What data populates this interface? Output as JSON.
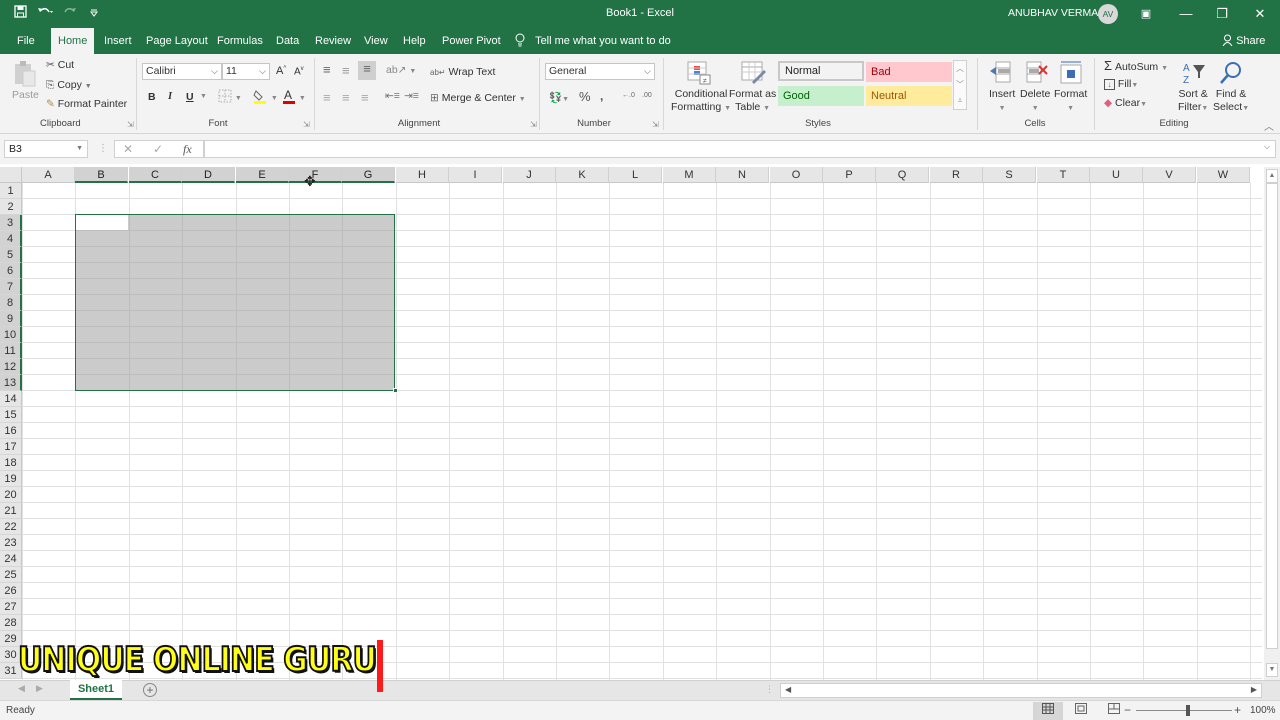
{
  "titlebar": {
    "doc_title": "Book1",
    "app_name": "Excel",
    "title_sep": "-",
    "user_name": "ANUBHAV VERMA",
    "user_initials": "AV",
    "qat": {
      "save": "save-icon",
      "undo": "undo-icon",
      "redo": "redo-icon",
      "customize": "customize-icon"
    },
    "window_controls": {
      "ribbon_display": "▣",
      "minimize": "—",
      "restore": "❐",
      "close": "✕"
    }
  },
  "tabs": [
    {
      "label": "File"
    },
    {
      "label": "Home",
      "active": true
    },
    {
      "label": "Insert"
    },
    {
      "label": "Page Layout"
    },
    {
      "label": "Formulas"
    },
    {
      "label": "Data"
    },
    {
      "label": "Review"
    },
    {
      "label": "View"
    },
    {
      "label": "Help"
    },
    {
      "label": "Power Pivot"
    }
  ],
  "tell_me": "Tell me what you want to do",
  "share": "Share",
  "ribbon": {
    "clipboard": {
      "label": "Clipboard",
      "paste": "Paste",
      "cut": "Cut",
      "copy": "Copy",
      "format_painter": "Format Painter"
    },
    "font": {
      "label": "Font",
      "font_name": "Calibri",
      "font_size": "11",
      "bold": "B",
      "italic": "I",
      "underline": "U",
      "grow": "A",
      "shrink": "A"
    },
    "alignment": {
      "label": "Alignment",
      "wrap_text": "Wrap Text",
      "merge_center": "Merge & Center"
    },
    "number": {
      "label": "Number",
      "format": "General",
      "percent": "%",
      "comma": ",",
      "inc_decimal": "←.0",
      "dec_decimal": ".00"
    },
    "styles": {
      "label": "Styles",
      "conditional_formatting_1": "Conditional",
      "conditional_formatting_2": "Formatting",
      "format_as_table_1": "Format as",
      "format_as_table_2": "Table",
      "cell_styles": [
        {
          "name": "Normal",
          "bg": "#ffffff",
          "fg": "#222222"
        },
        {
          "name": "Bad",
          "bg": "#ffc7ce",
          "fg": "#9c0006"
        },
        {
          "name": "Good",
          "bg": "#c6efce",
          "fg": "#006100"
        },
        {
          "name": "Neutral",
          "bg": "#ffeb9c",
          "fg": "#9c5700"
        }
      ]
    },
    "cells": {
      "label": "Cells",
      "insert": "Insert",
      "delete": "Delete",
      "format": "Format"
    },
    "editing": {
      "label": "Editing",
      "autosum": "AutoSum",
      "fill": "Fill",
      "clear": "Clear",
      "sort_filter_1": "Sort &",
      "sort_filter_2": "Filter",
      "find_select_1": "Find &",
      "find_select_2": "Select"
    }
  },
  "formula_bar": {
    "name_box": "B3",
    "cancel": "✕",
    "enter": "✓",
    "fx": "fx",
    "formula": ""
  },
  "sheet": {
    "columns": [
      "A",
      "B",
      "C",
      "D",
      "E",
      "F",
      "G",
      "H",
      "I",
      "J",
      "K",
      "L",
      "M",
      "N",
      "O",
      "P",
      "Q",
      "R",
      "S",
      "T",
      "U",
      "V",
      "W"
    ],
    "rows": [
      1,
      2,
      3,
      4,
      5,
      6,
      7,
      8,
      9,
      10,
      11,
      12,
      13,
      14,
      15,
      16,
      17,
      18,
      19,
      20,
      21,
      22,
      23,
      24,
      25,
      26,
      27,
      28,
      29,
      30,
      31
    ],
    "selection": {
      "range": "B3:G13",
      "active_cell": "B3"
    }
  },
  "sheet_tabs": {
    "tabs": [
      "Sheet1"
    ],
    "active": "Sheet1",
    "add": "+"
  },
  "status": {
    "mode": "Ready",
    "zoom": "100%",
    "zoom_minus": "−",
    "zoom_plus": "+"
  },
  "watermark": {
    "text": "UNIQUE ONLINE GURU"
  },
  "colors": {
    "brand": "#217346",
    "selection": "#217346"
  }
}
